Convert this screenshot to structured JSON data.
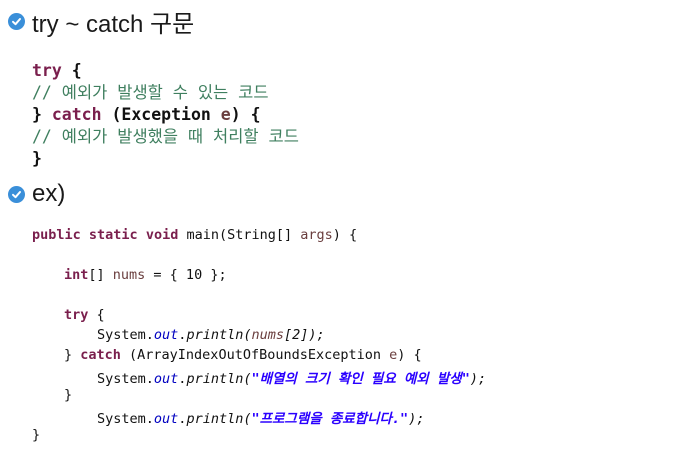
{
  "section1": {
    "title": "try ~ catch 구문",
    "code": {
      "l1_kw": "try",
      "l1_rest": " {",
      "l2_comment": "// 예외가 발생할 수 있는 코드",
      "l3_open": "} ",
      "l3_kw": "catch",
      "l3_paren_open": " (Exception ",
      "l3_var": "e",
      "l3_paren_close": ") {",
      "l4_comment": "// 예외가 발생했을 때 처리할 코드",
      "l5_close": "}"
    }
  },
  "section2": {
    "title": "ex)",
    "code": {
      "m_kw1": "public",
      "m_kw2": "static",
      "m_kw3": "void",
      "m_name": " main(String[] ",
      "m_args": "args",
      "m_rest": ") {",
      "a_kw": "int",
      "a_mid": "[] ",
      "a_var": "nums",
      "a_rest": " = { 10 };",
      "t_kw": "try",
      "t_rest": " {",
      "p1_sys": "System.",
      "p1_out": "out",
      "p1_dot": ".",
      "p1_method": "println(",
      "p1_var": "nums",
      "p1_rest": "[2]);",
      "c_open": "} ",
      "c_kw": "catch",
      "c_mid": " (ArrayIndexOutOfBoundsException ",
      "c_var": "e",
      "c_rest": ") {",
      "p2_sys": "System.",
      "p2_out": "out",
      "p2_dot": ".",
      "p2_method": "println(",
      "p2_str": "\"배열의 크기 확인 필요 예외 발생\"",
      "p2_rest": ");",
      "cl1": "}",
      "p3_sys": "System.",
      "p3_out": "out",
      "p3_dot": ".",
      "p3_method": "println(",
      "p3_str": "\"프로그램을 종료합니다.\"",
      "p3_rest": ");",
      "cl2": "}"
    }
  },
  "colors": {
    "check_blue": "#3a8fd9",
    "keyword": "#7a1f4d",
    "comment": "#3f7f5f",
    "string": "#2a00ff",
    "field": "#0000c0"
  }
}
